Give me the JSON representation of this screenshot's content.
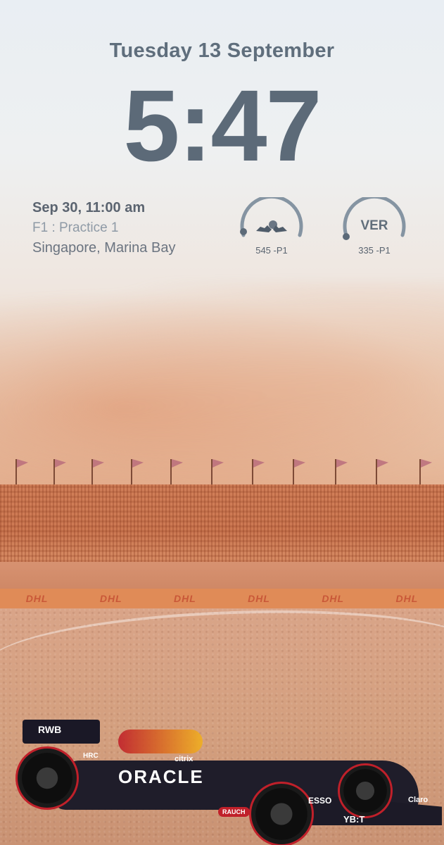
{
  "lock_screen": {
    "date": "Tuesday 13 September",
    "time": "5:47"
  },
  "calendar_widget": {
    "when": "Sep 30, 11:00 am",
    "title": "F1 : Practice 1",
    "location": "Singapore, Marina Bay"
  },
  "standings_widgets": [
    {
      "icon": "red-bull-icon",
      "caption": "545 -P1"
    },
    {
      "label": "VER",
      "caption": "335 -P1"
    }
  ],
  "wallpaper": {
    "banner_text": "DHL",
    "car_sponsors": {
      "main": "ORACLE",
      "rear": "RWB",
      "citrix": "citrix",
      "esso": "ESSO",
      "claro": "Claro",
      "rauch": "RAUCH",
      "hrc": "HRC",
      "bybit": "YB:T"
    }
  },
  "colors": {
    "text_primary": "#5c6a78",
    "text_secondary": "#8e9aa6",
    "sky": "#e9eef3",
    "dust_orange": "#c36f48"
  }
}
